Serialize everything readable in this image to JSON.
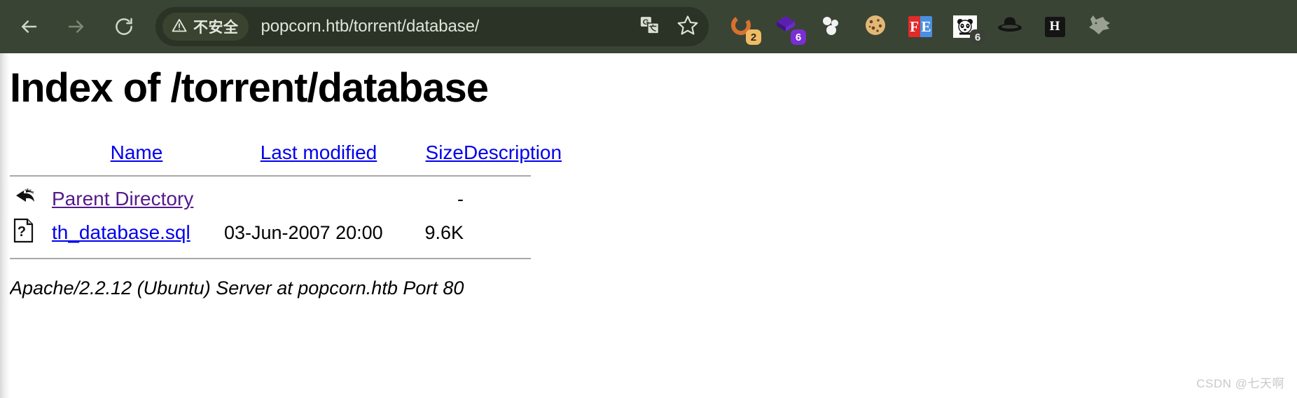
{
  "browser": {
    "nav": {
      "back_label": "Back",
      "forward_label": "Forward",
      "reload_label": "Reload"
    },
    "omnibox": {
      "security_text": "不安全",
      "security_icon": "warning-triangle-icon",
      "url": "popcorn.htb/torrent/database/",
      "translate_label": "Translate",
      "bookmark_label": "Bookmark this tab"
    },
    "toolbar_bg": "#3a4434",
    "omnibox_bg": "#2a3325",
    "extensions": [
      {
        "name": "ring-extension",
        "icon": "orange-ring-icon",
        "badge": "2",
        "badge_style": "amber"
      },
      {
        "name": "diamond-extension",
        "icon": "purple-diamond-icon",
        "badge": "6",
        "badge_style": "purple"
      },
      {
        "name": "bubbles-extension",
        "icon": "white-bubbles-icon",
        "badge": "",
        "badge_style": ""
      },
      {
        "name": "cookie-extension",
        "icon": "cookie-icon",
        "badge": "",
        "badge_style": ""
      },
      {
        "name": "fe-extension",
        "icon": "fe-logo-icon",
        "badge": "",
        "badge_style": "",
        "text_left": "F",
        "text_right": "E"
      },
      {
        "name": "panda-extension",
        "icon": "panda-icon",
        "badge": "6",
        "badge_style": "dark"
      },
      {
        "name": "blackhat-extension",
        "icon": "black-hat-icon",
        "badge": "",
        "badge_style": ""
      },
      {
        "name": "h-extension",
        "icon": "letter-h-icon",
        "badge": "",
        "badge_style": "",
        "text": "H"
      },
      {
        "name": "wolf-extension",
        "icon": "wolf-head-icon",
        "badge": "",
        "badge_style": ""
      }
    ]
  },
  "page": {
    "title": "Index of /torrent/database",
    "table": {
      "headers": {
        "name": "Name",
        "last_modified": "Last modified",
        "size": "Size",
        "description": "Description"
      },
      "rows": [
        {
          "icon": "parent-directory-icon",
          "name": "Parent Directory",
          "link_state": "visited",
          "last_modified": "",
          "size": "-",
          "description": ""
        },
        {
          "icon": "unknown-file-icon",
          "name": "th_database.sql",
          "link_state": "unvisited",
          "last_modified": "03-Jun-2007 20:00",
          "size": "9.6K",
          "description": ""
        }
      ]
    },
    "footer": "Apache/2.2.12 (Ubuntu) Server at popcorn.htb Port 80"
  },
  "watermark": "CSDN @七天啊",
  "colors": {
    "link_unvisited": "#0000ee",
    "link_visited": "#551a8b",
    "toolbar": "#3a4434",
    "rule": "#a8a8a8"
  }
}
